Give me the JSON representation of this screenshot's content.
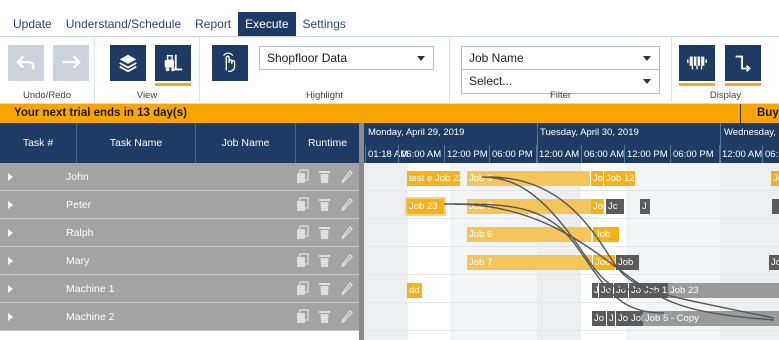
{
  "menu": {
    "tabs": [
      {
        "label": "Update"
      },
      {
        "label": "Understand/Schedule"
      },
      {
        "label": "Report"
      },
      {
        "label": "Execute"
      },
      {
        "label": "Settings"
      }
    ],
    "active": "Execute"
  },
  "ribbon": {
    "undo_redo_label": "Undo/Redo",
    "view_label": "View",
    "highlight_label": "Highlight",
    "highlight_value": "Shopfloor Data",
    "filter_label": "Filter",
    "filter_field": "Job Name",
    "filter_value": "Select...",
    "display_label": "Display",
    "accent": "#f5a623",
    "dark": "#1f3b63"
  },
  "trial": {
    "message": "Your next trial ends in 13 day(s)",
    "buy": "Buy"
  },
  "grid": {
    "columns": [
      "Task #",
      "Task Name",
      "Job Name",
      "Runtime"
    ],
    "rows": [
      {
        "name": "John"
      },
      {
        "name": "Peter"
      },
      {
        "name": "Ralph"
      },
      {
        "name": "Mary"
      },
      {
        "name": "Machine 1"
      },
      {
        "name": "Machine 2"
      }
    ],
    "row_color": "#a3a3a3"
  },
  "gantt": {
    "days": [
      "Monday, April 29, 2019",
      "Tuesday, April 30, 2019",
      "Wednesday, M"
    ],
    "hours": [
      "01:18 AM",
      "06:00 AM",
      "12:00 PM",
      "06:00 PM",
      "12:00 AM",
      "06:00 AM",
      "12:00 PM",
      "06:00 PM",
      "12:00 AM",
      "06:"
    ],
    "rows": [
      [
        {
          "label": "test e",
          "kind": "gold"
        },
        {
          "label": "Job 23",
          "kind": "gold"
        },
        {
          "label": "Job 3",
          "kind": "light"
        },
        {
          "label": "Jo",
          "kind": "gold"
        },
        {
          "label": "Job 12",
          "kind": "gold"
        },
        {
          "label": "Jo",
          "kind": "gold"
        }
      ],
      [
        {
          "label": "Job 23",
          "kind": "gold"
        },
        {
          "label": "Job 7",
          "kind": "light"
        },
        {
          "label": "Jo",
          "kind": "gold"
        },
        {
          "label": "Jc",
          "kind": "dark"
        },
        {
          "label": "J",
          "kind": "dark"
        },
        {
          "label": "",
          "kind": "dark"
        }
      ],
      [
        {
          "label": "Job 6",
          "kind": "light"
        },
        {
          "label": "Job",
          "kind": "gold"
        }
      ],
      [
        {
          "label": "Job 7",
          "kind": "light"
        },
        {
          "label": "Job",
          "kind": "gold"
        },
        {
          "label": "Job",
          "kind": "dark"
        },
        {
          "label": "Jo",
          "kind": "dark"
        }
      ],
      [
        {
          "label": "dd",
          "kind": "gold"
        },
        {
          "label": "J",
          "kind": "dark"
        },
        {
          "label": "Jo",
          "kind": "dark"
        },
        {
          "label": "Jo",
          "kind": "dark"
        },
        {
          "label": "Jo",
          "kind": "dark"
        },
        {
          "label": "Job 12",
          "kind": "dark"
        },
        {
          "label": "Job 23",
          "kind": "grey"
        }
      ],
      [
        {
          "label": "Jo",
          "kind": "dark"
        },
        {
          "label": "J",
          "kind": "dark"
        },
        {
          "label": "Jo",
          "kind": "dark"
        },
        {
          "label": "Jol",
          "kind": "dark"
        },
        {
          "label": "Job 5 - Copy",
          "kind": "grey"
        }
      ]
    ],
    "colors": {
      "gold": "#f7b21a",
      "light": "#f4c55a",
      "dark": "#5b5b5b",
      "grey": "#9a9a9a"
    }
  }
}
